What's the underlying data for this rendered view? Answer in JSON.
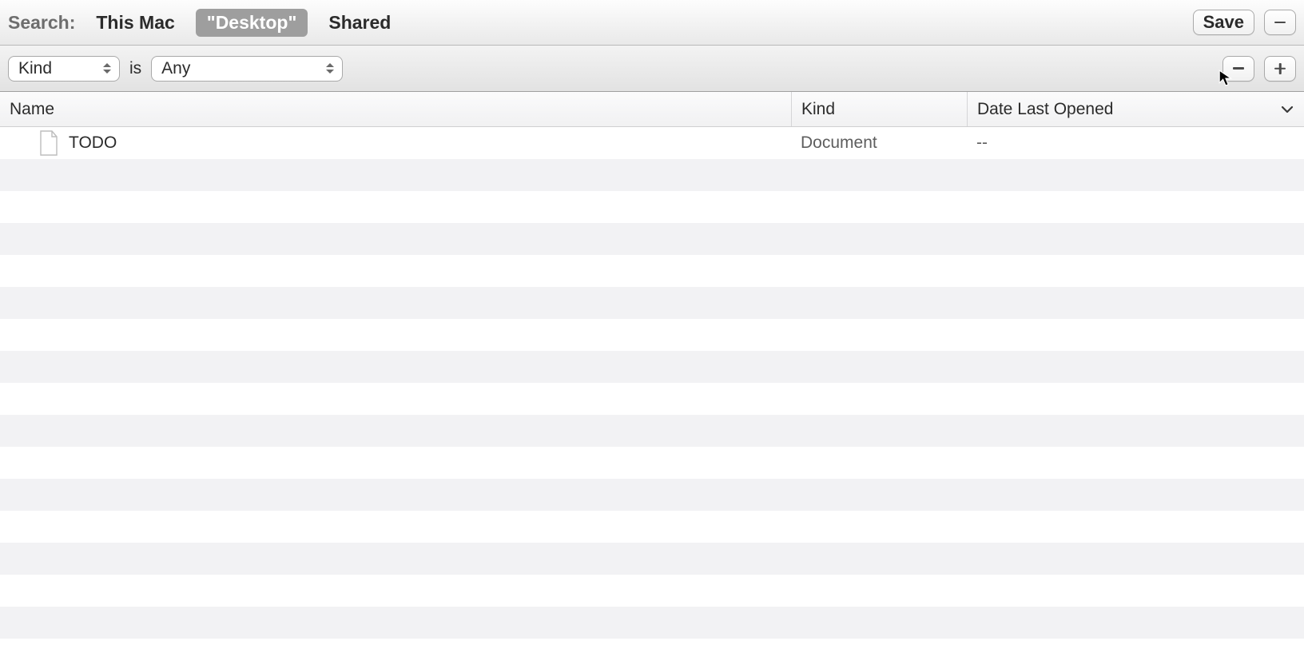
{
  "scope": {
    "label": "Search:",
    "tabs": [
      "This Mac",
      "\"Desktop\"",
      "Shared"
    ],
    "active_index": 1,
    "save_label": "Save"
  },
  "criteria": {
    "attribute": "Kind",
    "operator": "is",
    "value": "Any"
  },
  "columns": {
    "name": "Name",
    "kind": "Kind",
    "date": "Date Last Opened"
  },
  "rows": [
    {
      "name": "TODO",
      "kind": "Document",
      "date": "--"
    }
  ]
}
